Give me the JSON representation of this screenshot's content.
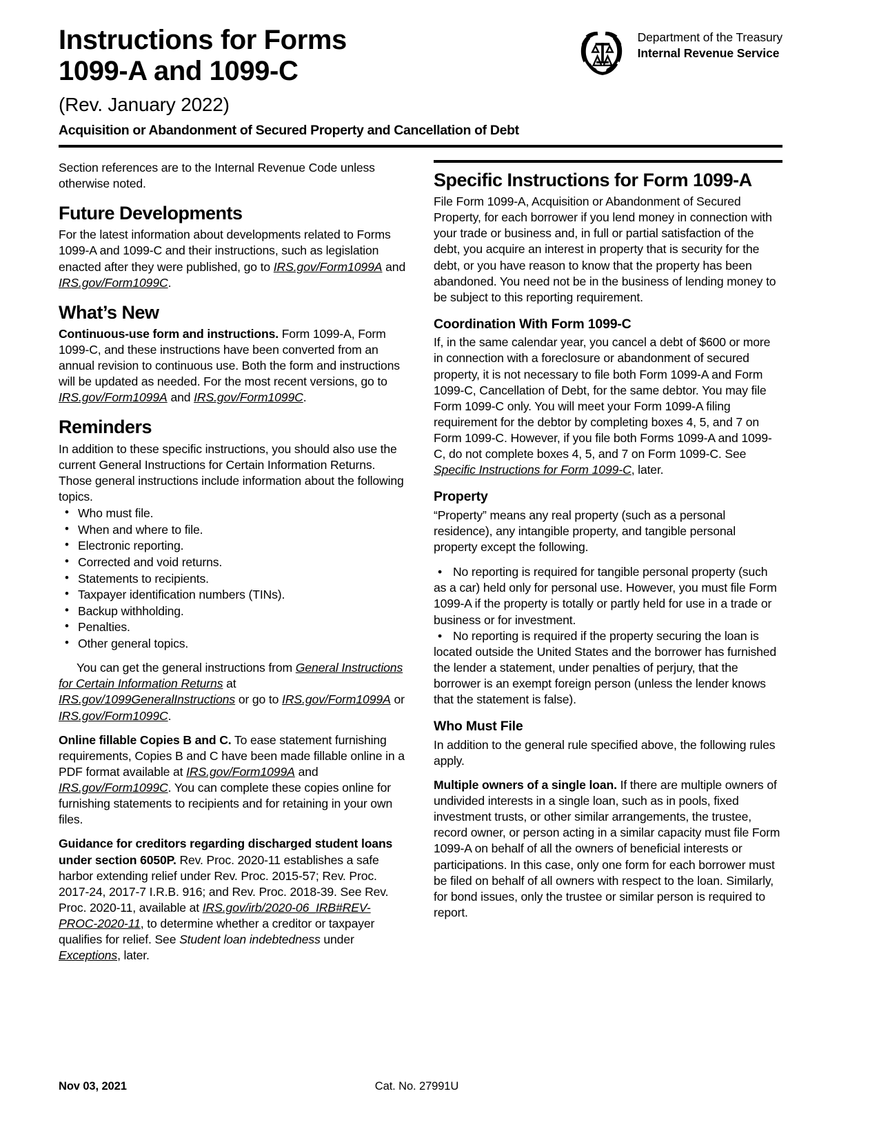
{
  "header": {
    "title_line1": "Instructions for Forms",
    "title_line2": "1099-A and 1099-C",
    "revision": "(Rev. January 2022)",
    "subtitle": "Acquisition or Abandonment of Secured Property and Cancellation of Debt",
    "agency_department": "Department of the Treasury",
    "agency_service": "Internal Revenue Service",
    "seal_icon": "irs-eagle-scales-seal"
  },
  "left_column": {
    "section_note": "Section references are to the Internal Revenue Code unless otherwise noted.",
    "future_developments": {
      "heading": "Future Developments",
      "text_before": "For the latest information about developments related to Forms 1099-A and 1099-C and their instructions, such as legislation enacted after they were published, go to ",
      "link1": "IRS.gov/Form1099A",
      "text_mid": " and ",
      "link2": "IRS.gov/Form1099C",
      "text_after": "."
    },
    "whats_new": {
      "heading": "What’s New",
      "lead": "Continuous-use form and instructions.",
      "text_before": "  Form 1099-A, Form 1099-C, and these instructions have been converted from an annual revision to continuous use. Both the form and instructions will be updated as needed. For the most recent versions, go to ",
      "link1": "IRS.gov/Form1099A",
      "text_mid": " and ",
      "link2": "IRS.gov/Form1099C",
      "text_after": "."
    },
    "reminders": {
      "heading": "Reminders",
      "intro": "In addition to these specific instructions, you should also use the current General Instructions for Certain Information Returns. Those general instructions include information about the following topics.",
      "bullets": [
        "Who must file.",
        "When and where to file.",
        "Electronic reporting.",
        "Corrected and void returns.",
        "Statements to recipients.",
        "Taxpayer identification numbers (TINs).",
        "Backup withholding.",
        "Penalties.",
        "Other general topics."
      ],
      "general_para": {
        "text_before": "You can get the general instructions from ",
        "link1": "General Instructions for Certain Information Returns",
        "text_mid1": " at ",
        "link2": "IRS.gov/1099GeneralInstructions",
        "text_mid2": " or go to ",
        "link3": "IRS.gov/Form1099A",
        "text_mid3": " or ",
        "link4": "IRS.gov/Form1099C",
        "text_after": "."
      },
      "online_fillable": {
        "lead": "Online fillable Copies B and C.",
        "text_before": "  To ease statement furnishing requirements, Copies B and C have been made fillable online in a PDF format available at ",
        "link1": "IRS.gov/Form1099A",
        "text_mid": " and ",
        "link2": "IRS.gov/Form1099C",
        "text_after": ". You can complete these copies online for furnishing statements to recipients and for retaining in your own files."
      },
      "student_loans": {
        "lead": "Guidance for creditors regarding discharged student loans under section 6050P.",
        "text_before": "  Rev. Proc. 2020-11 establishes a safe harbor extending relief under Rev. Proc. 2015-57; Rev. Proc. 2017-24, 2017-7 I.R.B. 916; and Rev. Proc. 2018-39. See Rev. Proc. 2020-11, available at ",
        "link1": "IRS.gov/irb/2020-06_IRB#REV-PROC-2020-11",
        "text_mid1": ", to determine whether a creditor or taxpayer qualifies for relief. See ",
        "italic1": "Student loan indebtedness",
        "text_mid2": " under ",
        "link2": "Exceptions",
        "text_after": ", later."
      }
    }
  },
  "right_column": {
    "specific_1099a": {
      "heading": "Specific Instructions for Form 1099-A",
      "text": "File Form 1099-A, Acquisition or Abandonment of Secured Property, for each borrower if you lend money in connection with your trade or business and, in full or partial satisfaction of the debt, you acquire an interest in property that is security for the debt, or you have reason to know that the property has been abandoned. You need not be in the business of lending money to be subject to this reporting requirement."
    },
    "coordination": {
      "heading": "Coordination With Form 1099-C",
      "text_before": "If, in the same calendar year, you cancel a debt of $600 or more in connection with a foreclosure or abandonment of secured property, it is not necessary to file both Form 1099-A and Form 1099-C, Cancellation of Debt, for the same debtor. You may file Form 1099-C only. You will meet your Form 1099-A filing requirement for the debtor by completing boxes 4, 5, and 7 on Form 1099-C. However, if you file both Forms 1099-A and 1099-C, do not complete boxes 4, 5, and 7 on Form 1099-C. See ",
      "link1": "Specific Instructions for Form 1099-C",
      "text_after": ", later."
    },
    "property": {
      "heading": "Property",
      "text": "“Property” means any real property (such as a personal residence), any intangible property, and tangible personal property except the following.",
      "bullets": [
        "No reporting is required for tangible personal property (such as a car) held only for personal use. However, you must file Form 1099-A if the property is totally or partly held for use in a trade or business or for investment.",
        "No reporting is required if the property securing the loan is located outside the United States and the borrower has furnished the lender a statement, under penalties of perjury, that the borrower is an exempt foreign person (unless the lender knows that the statement is false)."
      ]
    },
    "who_must_file": {
      "heading": "Who Must File",
      "text": "In addition to the general rule specified above, the following rules apply.",
      "multiple_owners": {
        "lead": "Multiple owners of a single loan.",
        "text": "  If there are multiple owners of undivided interests in a single loan, such as in pools, fixed investment trusts, or other similar arrangements, the trustee, record owner, or person acting in a similar capacity must file Form 1099-A on behalf of all the owners of beneficial interests or participations. In this case, only one form for each borrower must be filed on behalf of all owners with respect to the loan. Similarly, for bond issues, only the trustee or similar person is required to report."
      }
    }
  },
  "footer": {
    "date": "Nov 03, 2021",
    "catalog": "Cat. No. 27991U"
  }
}
